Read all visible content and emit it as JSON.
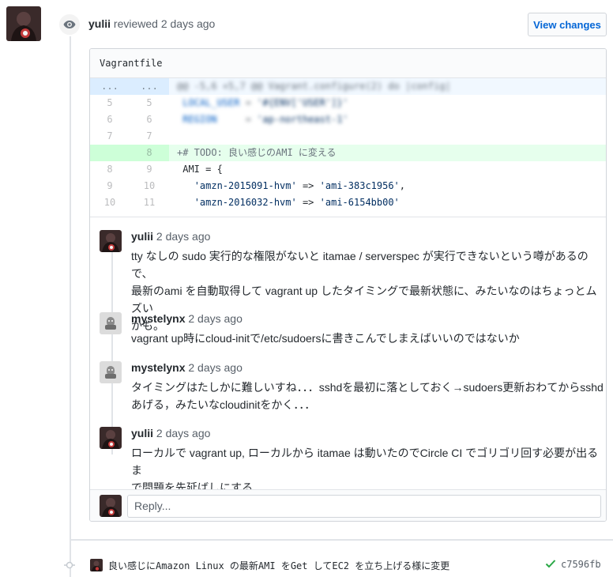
{
  "review": {
    "author": "yulii",
    "action_text": "reviewed 2 days ago",
    "view_changes_label": "View changes"
  },
  "file": {
    "name": "Vagrantfile",
    "hunk_marker_old": "...",
    "hunk_marker_new": "...",
    "rows": [
      {
        "old": "5",
        "new": "5"
      },
      {
        "old": "6",
        "new": "6"
      },
      {
        "old": "7",
        "new": "7"
      },
      {
        "old": "",
        "new": "8",
        "code": "+# TODO: 良い感じのAMI に変える"
      },
      {
        "old": "8",
        "new": "9",
        "code": " AMI = {"
      },
      {
        "old": "9",
        "new": "10",
        "code_key": "'amzn-2015091-hvm'",
        "code_arrow": " => ",
        "code_val": "'ami-383c1956'",
        "code_tail": ","
      },
      {
        "old": "10",
        "new": "11",
        "code_key": "'amzn-2016032-hvm'",
        "code_arrow": " => ",
        "code_val": "'ami-6154bb00'",
        "code_tail": ""
      }
    ]
  },
  "comments": [
    {
      "author": "yulii",
      "time": "2 days ago",
      "body_lines": [
        "tty なしの sudo 実行的な権限がないと itamae / serverspec が実行できないという噂があるので、",
        "最新のami を自動取得して vagrant up したタイミングで最新状態に、みたいなのはちょっとムズい",
        "かも。"
      ]
    },
    {
      "author": "mystelynx",
      "time": "2 days ago",
      "body_lines": [
        "vagrant up時にcloud-initで/etc/sudoersに書きこんでしまえばいいのではないか"
      ]
    },
    {
      "author": "mystelynx",
      "time": "2 days ago",
      "body_lines": [
        "タイミングはたしかに難しいすね．．．sshdを最初に落としておく→sudoers更新おわてからsshd",
        "あげる，みたいなcloudinitをかく．．．"
      ]
    },
    {
      "author": "yulii",
      "time": "2 days ago",
      "body_lines": [
        "ローカルで vagrant up, ローカルから itamae は動いたのでCircle CI でゴリゴリ回す必要が出るま",
        "で問題を先延ばしにする..."
      ]
    }
  ],
  "reply": {
    "placeholder": "Reply..."
  },
  "commit": {
    "message": "良い感じにAmazon Linux の最新AMI をGet してEC2 を立ち上げる様に変更",
    "sha": "c7596fb",
    "status_icon": "check-icon"
  },
  "colors": {
    "link": "#0366d6",
    "added_bg": "#e6ffed",
    "hunk_bg": "#f1f8ff",
    "success": "#28a745"
  }
}
